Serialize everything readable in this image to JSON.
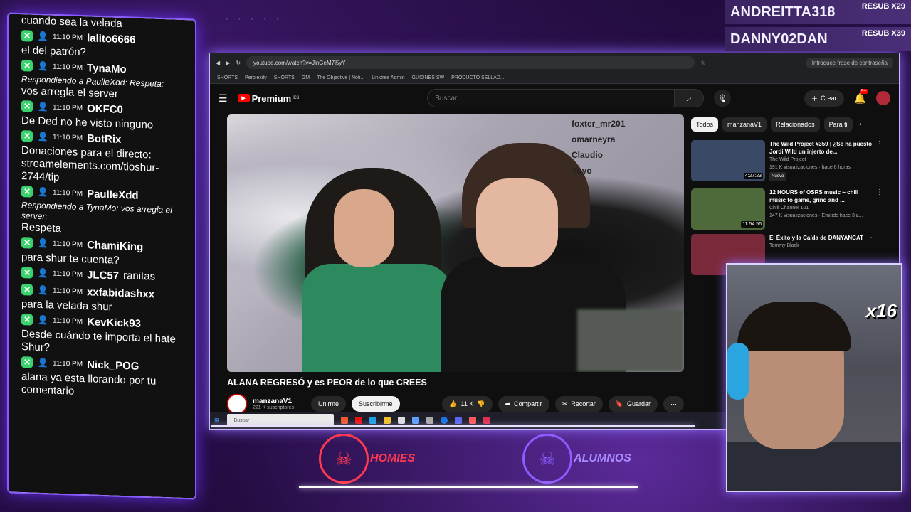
{
  "chat": {
    "messages": [
      {
        "text": "cuando sea la velada"
      },
      {
        "time": "11:10 PM",
        "user": "lalito6666",
        "text": "el del patrón?"
      },
      {
        "time": "11:10 PM",
        "user": "TynaMo",
        "reply": "Respondiendo a PaulleXdd: Respeta:",
        "text": "vos arregla el server"
      },
      {
        "time": "11:10 PM",
        "user": "OKFC0",
        "text": "De Ded no he visto ninguno"
      },
      {
        "time": "11:10 PM",
        "user": "BotRix",
        "text": "Donaciones para el directo: streamelements.com/tioshur-2744/tip"
      },
      {
        "time": "11:10 PM",
        "user": "PaulleXdd",
        "reply": "Respondiendo a TynaMo: vos arregla el server:",
        "text": "Respeta"
      },
      {
        "time": "11:10 PM",
        "user": "ChamiKing",
        "text": "para shur te cuenta?"
      },
      {
        "time": "11:10 PM",
        "user": "JLC57",
        "inline": "ranitas"
      },
      {
        "time": "11:10 PM",
        "user": "xxfabidashxx",
        "text": "para la velada shur"
      },
      {
        "time": "11:10 PM",
        "user": "KevKick93",
        "text": "Desde cuándo te importa el hate Shur?"
      },
      {
        "time": "11:10 PM",
        "user": "Nick_POG",
        "text": "alana ya esta llorando por tu comentario"
      }
    ]
  },
  "browser": {
    "url": "youtube.com/watch?v=JinGeM7j5yY",
    "password_chip": "Introduce frase de contraseña",
    "bookmarks": [
      "SHORTS",
      "Perplexity",
      "SHORTS",
      "GM",
      "The Objective | Noti...",
      "Linktree Admin",
      "GUIONES SW",
      "PRODUCTO SELLAD..."
    ]
  },
  "youtube": {
    "logo": "Premium",
    "logo_region": "ES",
    "search_placeholder": "Buscar",
    "create_label": "Crear",
    "notif_count": "9+",
    "video_overlay_chat": [
      "foxter_mr201",
      "omarneyra",
      "Claudio",
      "Yuyo"
    ],
    "video_title": "ALANA REGRESÓ y es PEOR de lo que CREES",
    "channel_name": "manzanaV1",
    "channel_subs": "221 K suscriptores",
    "join_label": "Unirme",
    "subscribe_label": "Suscribirme",
    "likes": "11 K",
    "share_label": "Compartir",
    "clip_label": "Recortar",
    "save_label": "Guardar",
    "chips": [
      "Todos",
      "manzanaV1",
      "Relacionados",
      "Para ti"
    ],
    "recommendations": [
      {
        "title": "The Wild Project #359 | ¿Se ha puesto Jordi Wild un injerto de...",
        "channel": "The Wild Project",
        "meta": "191 K visualizaciones · hace 6 horas",
        "badge": "Nuevo",
        "duration": "4:27:23",
        "thumb_color": "#3a4a66"
      },
      {
        "title": "12 HOURS of OSRS music ~ chill music to game, grind and ...",
        "channel": "Chill Channel 101",
        "meta": "147 K visualizaciones · Emitido hace 3 a...",
        "duration": "11:54:56",
        "thumb_color": "#4f6a3a"
      },
      {
        "title": "El Éxito y la Caída de DANYANCAT",
        "channel": "Tommy Black",
        "meta": "",
        "thumb_color": "#7a2a3a"
      }
    ],
    "taskbar_search": "Buscar"
  },
  "subs": [
    {
      "name": "ANDREITTA318",
      "tag": "RESUB X29"
    },
    {
      "name": "DANNY02DAN",
      "tag": "RESUB X39"
    }
  ],
  "cam": {
    "multiplier": "x16"
  },
  "brands": [
    {
      "name": "HOMIES",
      "color": "#ff3a4f"
    },
    {
      "name": "ALUMNOS",
      "color": "#8d5bff"
    }
  ]
}
